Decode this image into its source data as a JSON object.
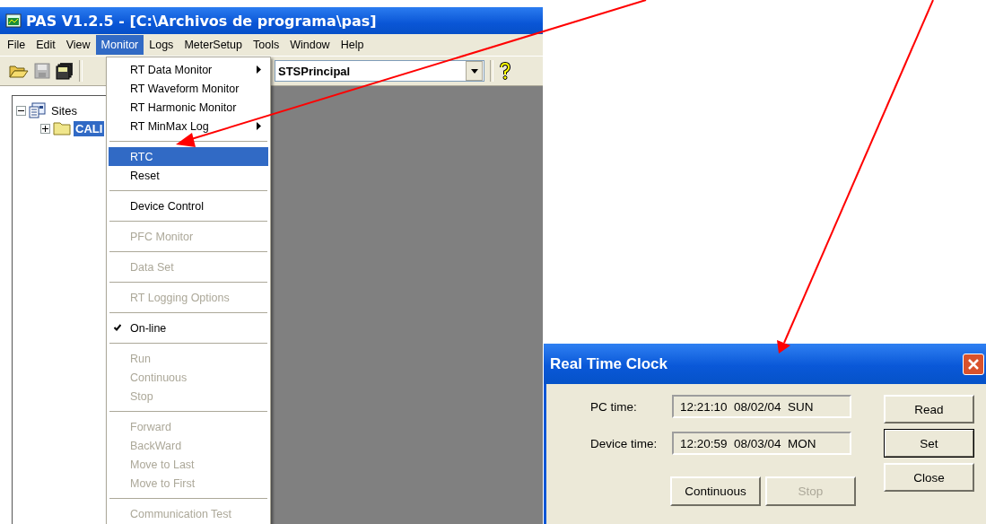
{
  "main_window": {
    "title": "PAS V1.2.5 - [C:\\Archivos de programa\\pas]",
    "menu_bar": [
      {
        "label": "File",
        "selected": false
      },
      {
        "label": "Edit",
        "selected": false
      },
      {
        "label": "View",
        "selected": false
      },
      {
        "label": "Monitor",
        "selected": true
      },
      {
        "label": "Logs",
        "selected": false
      },
      {
        "label": "MeterSetup",
        "selected": false
      },
      {
        "label": "Tools",
        "selected": false
      },
      {
        "label": "Window",
        "selected": false
      },
      {
        "label": "Help",
        "selected": false
      }
    ],
    "toolbar": {
      "site_combo": {
        "value": "STSPrincipal"
      }
    },
    "tree": [
      {
        "label": "Sites",
        "expanded": true,
        "selected": false,
        "children": [
          {
            "label": "CALI",
            "expanded": false,
            "selected": true
          }
        ]
      }
    ],
    "monitor_menu": [
      {
        "kind": "item",
        "label": "RT Data Monitor",
        "submenu": true,
        "disabled": false,
        "selected": false,
        "checked": false
      },
      {
        "kind": "item",
        "label": "RT Waveform Monitor",
        "submenu": false,
        "disabled": false,
        "selected": false,
        "checked": false
      },
      {
        "kind": "item",
        "label": "RT Harmonic Monitor",
        "submenu": false,
        "disabled": false,
        "selected": false,
        "checked": false
      },
      {
        "kind": "item",
        "label": "RT MinMax Log",
        "submenu": true,
        "disabled": false,
        "selected": false,
        "checked": false
      },
      {
        "kind": "separator"
      },
      {
        "kind": "item",
        "label": "RTC",
        "submenu": false,
        "disabled": false,
        "selected": true,
        "checked": false
      },
      {
        "kind": "item",
        "label": "Reset",
        "submenu": false,
        "disabled": false,
        "selected": false,
        "checked": false
      },
      {
        "kind": "separator"
      },
      {
        "kind": "item",
        "label": "Device Control",
        "submenu": false,
        "disabled": false,
        "selected": false,
        "checked": false
      },
      {
        "kind": "separator"
      },
      {
        "kind": "item",
        "label": "PFC Monitor",
        "submenu": false,
        "disabled": true,
        "selected": false,
        "checked": false
      },
      {
        "kind": "separator"
      },
      {
        "kind": "item",
        "label": "Data Set",
        "submenu": false,
        "disabled": true,
        "selected": false,
        "checked": false
      },
      {
        "kind": "separator"
      },
      {
        "kind": "item",
        "label": "RT Logging Options",
        "submenu": false,
        "disabled": true,
        "selected": false,
        "checked": false
      },
      {
        "kind": "separator"
      },
      {
        "kind": "item",
        "label": "On-line",
        "submenu": false,
        "disabled": false,
        "selected": false,
        "checked": true
      },
      {
        "kind": "separator"
      },
      {
        "kind": "item",
        "label": "Run",
        "submenu": false,
        "disabled": true,
        "selected": false,
        "checked": false
      },
      {
        "kind": "item",
        "label": "Continuous",
        "submenu": false,
        "disabled": true,
        "selected": false,
        "checked": false
      },
      {
        "kind": "item",
        "label": "Stop",
        "submenu": false,
        "disabled": true,
        "selected": false,
        "checked": false
      },
      {
        "kind": "separator"
      },
      {
        "kind": "item",
        "label": "Forward",
        "submenu": false,
        "disabled": true,
        "selected": false,
        "checked": false
      },
      {
        "kind": "item",
        "label": "BackWard",
        "submenu": false,
        "disabled": true,
        "selected": false,
        "checked": false
      },
      {
        "kind": "item",
        "label": "Move to Last",
        "submenu": false,
        "disabled": true,
        "selected": false,
        "checked": false
      },
      {
        "kind": "item",
        "label": "Move to First",
        "submenu": false,
        "disabled": true,
        "selected": false,
        "checked": false
      },
      {
        "kind": "separator"
      },
      {
        "kind": "item",
        "label": "Communication Test",
        "submenu": false,
        "disabled": true,
        "selected": false,
        "checked": false
      }
    ]
  },
  "dialog": {
    "title": "Real Time Clock",
    "fields": [
      {
        "label": "PC time:",
        "value": "12:21:10  08/02/04  SUN"
      },
      {
        "label": "Device time:",
        "value": "12:20:59  08/03/04  MON"
      }
    ],
    "side_buttons": [
      {
        "label": "Read",
        "default": false
      },
      {
        "label": "Set",
        "default": true
      },
      {
        "label": "Close",
        "default": false
      }
    ],
    "bottom_buttons": [
      {
        "label": "Continuous",
        "disabled": false
      },
      {
        "label": "Stop",
        "disabled": true
      }
    ]
  }
}
